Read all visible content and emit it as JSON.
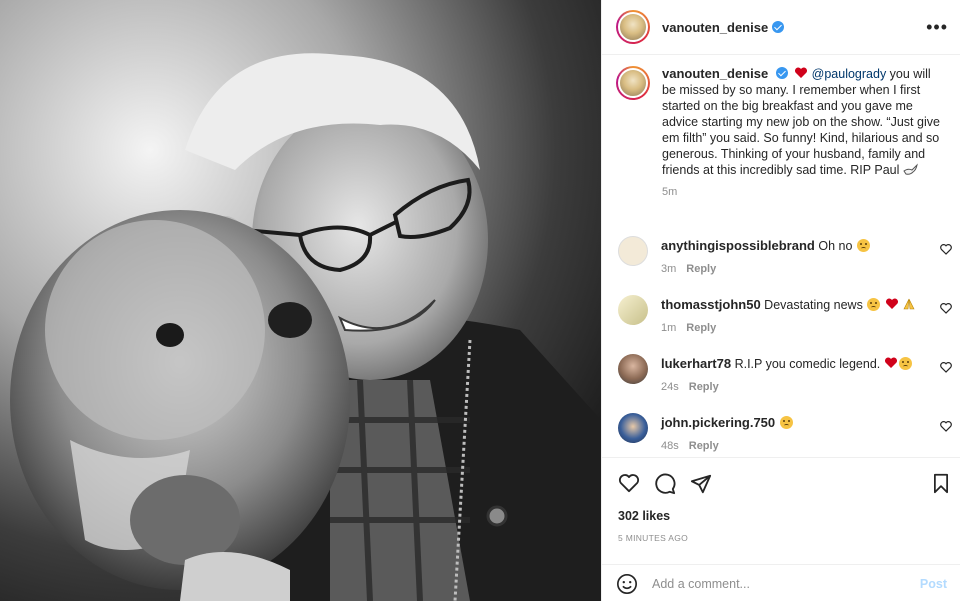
{
  "post": {
    "author": "vanouten_denise",
    "caption_mention": "@paulogrady",
    "caption_text": " you will be missed by so many. I remember when I first started on the big breakfast and you gave me advice starting my new job on the show. “Just give em filth” you said. So funny! Kind, hilarious and so generous. Thinking of your husband, family and friends at this incredibly sad time. RIP Paul",
    "caption_time": "5m",
    "likes": "302 likes",
    "posted_ago": "5 MINUTES AGO"
  },
  "comments": [
    {
      "user": "anythingispossiblebrand",
      "text": "Oh no",
      "time": "3m",
      "reply": "Reply"
    },
    {
      "user": "thomasstjohn50",
      "text": "Devastating news",
      "time": "1m",
      "reply": "Reply"
    },
    {
      "user": "lukerhart78",
      "text": "R.I.P you comedic legend.",
      "time": "24s",
      "reply": "Reply"
    },
    {
      "user": "john.pickering.750",
      "text": "",
      "time": "48s",
      "reply": "Reply"
    }
  ],
  "composer": {
    "placeholder": "Add a comment...",
    "post_label": "Post"
  },
  "icons": {
    "more": "more-options-icon",
    "like": "heart-outline-icon",
    "comment": "comment-bubble-icon",
    "share": "paper-plane-icon",
    "save": "bookmark-icon",
    "emoji": "emoji-smiley-icon"
  },
  "colors": {
    "verified": "#3897f0",
    "link": "#00376b",
    "muted": "#8e8e8e",
    "post_disabled": "#b3dbff",
    "heart_emoji": "#d0021b"
  }
}
